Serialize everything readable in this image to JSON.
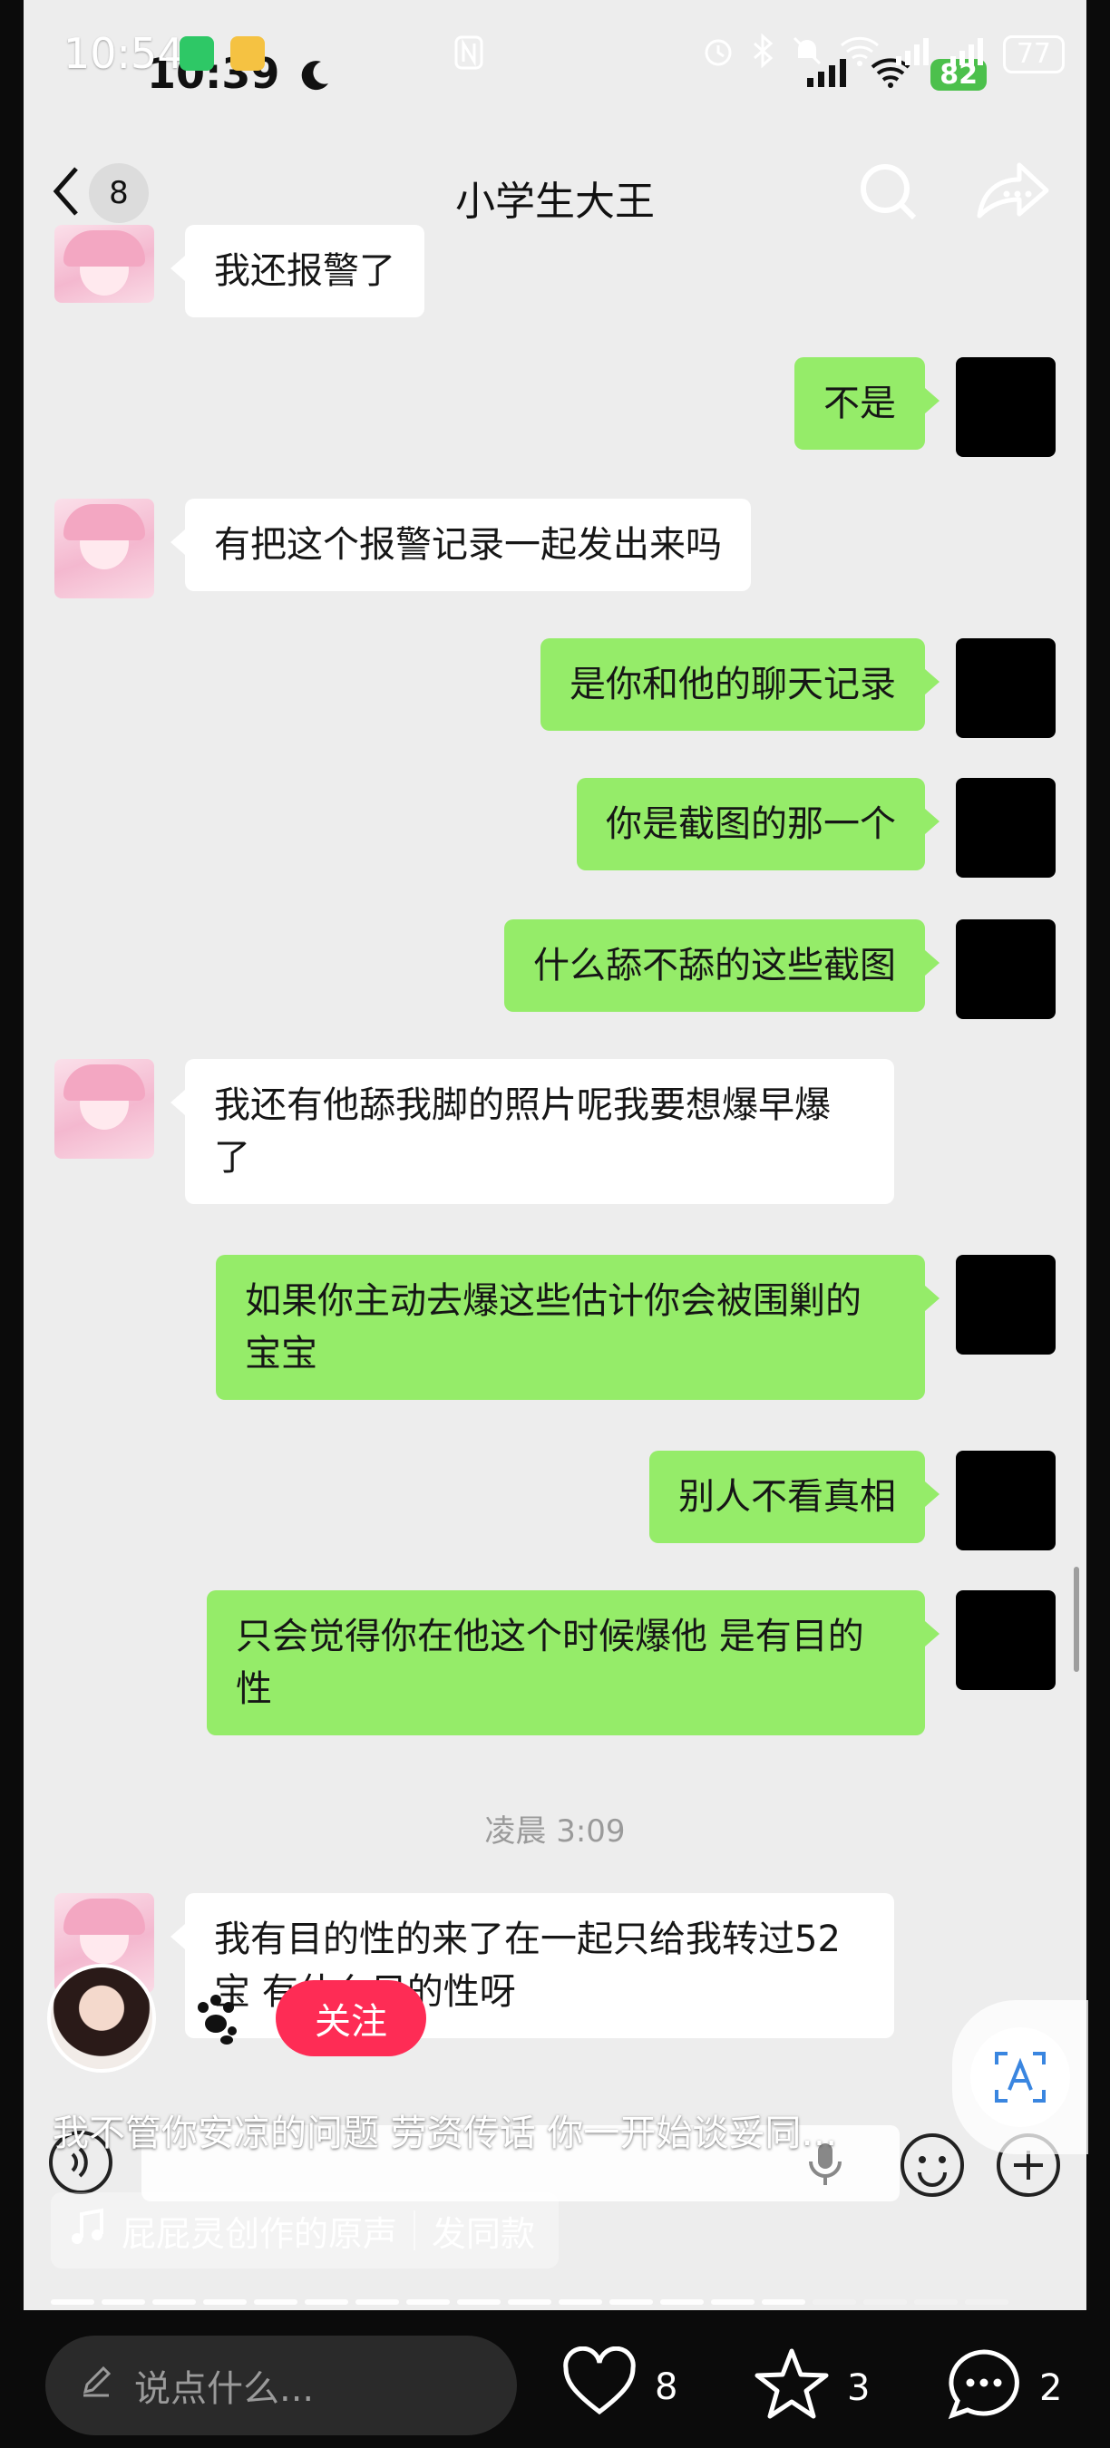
{
  "outer_status": {
    "time": "10:54",
    "battery": "77"
  },
  "inner_status": {
    "time": "10:39",
    "battery": "82"
  },
  "chat": {
    "back_count": "8",
    "title": "小学生大王"
  },
  "messages": [
    {
      "side": "left",
      "text": "我还报警了"
    },
    {
      "side": "right",
      "text": "不是"
    },
    {
      "side": "left",
      "text": "有把这个报警记录一起发出来吗"
    },
    {
      "side": "right",
      "text": "是你和他的聊天记录"
    },
    {
      "side": "right",
      "text": "你是截图的那一个"
    },
    {
      "side": "right",
      "text": "什么舔不舔的这些截图"
    },
    {
      "side": "left",
      "text": "我还有他舔我脚的照片呢我要想爆早爆了"
    },
    {
      "side": "right",
      "text": "如果你主动去爆这些估计你会被围剿的宝宝"
    },
    {
      "side": "right",
      "text": "别人不看真相"
    },
    {
      "side": "right",
      "text": "只会觉得你在他这个时候爆他 是有目的性"
    },
    {
      "side": "left",
      "text": "我有目的性的来了在一起只给我转过52宝 有什么目的性呀"
    }
  ],
  "timestamp": "凌晨 3:09",
  "video_overlay": {
    "follow_label": "关注",
    "caption": "我不管你安凉的问题 劳资传话 你一开始谈妥同…",
    "music_source": "屁屁灵创作的原声",
    "music_action": "发同款"
  },
  "bottom_bar": {
    "comment_placeholder": "说点什么...",
    "likes": "8",
    "favorites": "3",
    "comments": "2"
  }
}
